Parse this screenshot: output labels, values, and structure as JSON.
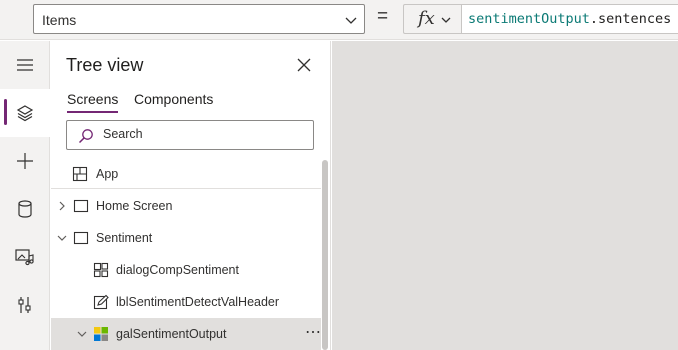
{
  "formula_bar": {
    "property": "Items",
    "equals": "=",
    "fx": "fx",
    "formula_parts": [
      {
        "text": "sentimentOutput",
        "kind": "identifier"
      },
      {
        "text": ".sentences",
        "kind": "plain"
      }
    ]
  },
  "rail": {
    "items": [
      {
        "icon": "hamburger-menu-icon",
        "active": false
      },
      {
        "icon": "layers-tree-view-icon",
        "active": true
      },
      {
        "icon": "plus-insert-icon",
        "active": false
      },
      {
        "icon": "database-icon",
        "active": false
      },
      {
        "icon": "media-icon",
        "active": false
      },
      {
        "icon": "advanced-tools-icon",
        "active": false
      }
    ]
  },
  "tree_view": {
    "title": "Tree view",
    "tabs": [
      {
        "label": "Screens",
        "active": true
      },
      {
        "label": "Components",
        "active": false
      }
    ],
    "search": {
      "placeholder": "Search",
      "value": ""
    },
    "items": [
      {
        "label": "App",
        "icon": "app-icon",
        "level": 0,
        "expander": "none",
        "selected": false
      },
      {
        "label": "Home Screen",
        "icon": "screen-icon",
        "level": 0,
        "expander": "collapsed",
        "selected": false
      },
      {
        "label": "Sentiment",
        "icon": "screen-icon",
        "level": 0,
        "expander": "expanded",
        "selected": false
      },
      {
        "label": "dialogCompSentiment",
        "icon": "component-icon",
        "level": 1,
        "expander": "none",
        "selected": false
      },
      {
        "label": "lblSentimentDetectValHeader",
        "icon": "label-edit-icon",
        "level": 1,
        "expander": "none",
        "selected": false
      },
      {
        "label": "galSentimentOutput",
        "icon": "gallery-icon",
        "level": 1,
        "expander": "expanded",
        "selected": true,
        "more": "⋯"
      }
    ]
  },
  "colors": {
    "accent": "#742774",
    "identifier": "#0b7a75",
    "panel_bg": "#f3f2f1",
    "canvas_bg": "#e1dfdd",
    "selected_row": "#e1dfdd"
  }
}
